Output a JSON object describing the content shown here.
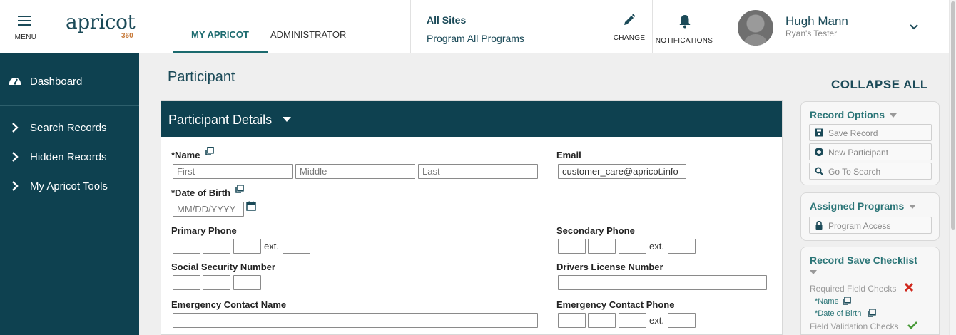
{
  "header": {
    "menu_label": "MENU",
    "logo_word": "apricot",
    "logo_sub": "360",
    "tabs": [
      {
        "label": "MY APRICOT",
        "active": true
      },
      {
        "label": "ADMINISTRATOR",
        "active": false
      }
    ],
    "site_label": "All Sites",
    "program_label": "Program All Programs",
    "change_label": "CHANGE",
    "notifications_label": "NOTIFICATIONS",
    "user_name": "Hugh Mann",
    "user_role": "Ryan's Tester"
  },
  "sidebar": {
    "items": [
      {
        "label": "Dashboard",
        "icon": "dashboard-icon"
      },
      {
        "label": "Search Records",
        "icon": "chevron-right-icon"
      },
      {
        "label": "Hidden Records",
        "icon": "chevron-right-icon"
      },
      {
        "label": "My Apricot Tools",
        "icon": "chevron-right-icon"
      }
    ]
  },
  "main": {
    "page_title": "Participant",
    "section_title": "Participant Details",
    "fields": {
      "name_label": "*Name",
      "first_placeholder": "First",
      "middle_placeholder": "Middle",
      "last_placeholder": "Last",
      "email_label": "Email",
      "email_value": "customer_care@apricot.info",
      "dob_label": "*Date of Birth",
      "dob_placeholder": "MM/DD/YYYY",
      "primary_phone_label": "Primary Phone",
      "secondary_phone_label": "Secondary Phone",
      "ext_label": "ext.",
      "ssn_label": "Social Security Number",
      "drivers_license_label": "Drivers License Number",
      "emergency_name_label": "Emergency Contact Name",
      "emergency_phone_label": "Emergency Contact Phone"
    }
  },
  "right_panel": {
    "collapse_all": "COLLAPSE ALL",
    "record_options": {
      "title": "Record Options",
      "buttons": [
        "Save Record",
        "New Participant",
        "Go To Search"
      ]
    },
    "assigned_programs": {
      "title": "Assigned Programs",
      "buttons": [
        "Program Access"
      ]
    },
    "checklist": {
      "title": "Record Save Checklist",
      "required_label": "Required Field Checks",
      "required_items": [
        "*Name",
        "*Date of Birth"
      ],
      "validation_label": "Field Validation Checks"
    }
  },
  "colors": {
    "primary_dark": "#0e4150",
    "accent_teal": "#2b7577",
    "error_red": "#d0281d",
    "success_green": "#4a9a3a"
  }
}
